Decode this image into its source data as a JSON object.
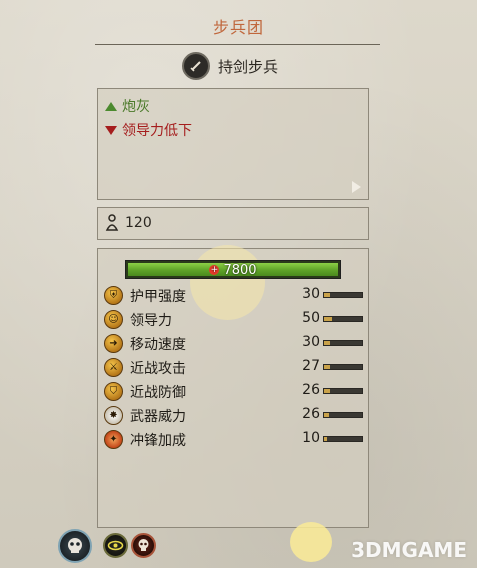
{
  "header": {
    "title": "步兵团"
  },
  "unit": {
    "type_label": "持剑步兵",
    "type_icon": "sword-icon"
  },
  "traits": [
    {
      "label": "炮灰",
      "kind": "positive",
      "color": "#4b7a2a"
    },
    {
      "label": "领导力低下",
      "kind": "negative",
      "color": "#a51d1d"
    }
  ],
  "men": {
    "count": "120"
  },
  "health": {
    "value": "7800",
    "fill_fraction": 1.0
  },
  "stats": [
    {
      "label": "护甲强度",
      "value": "30",
      "icon": "armor-icon",
      "fill": 0.15
    },
    {
      "label": "领导力",
      "value": "50",
      "icon": "leadership-icon",
      "fill": 0.2
    },
    {
      "label": "移动速度",
      "value": "30",
      "icon": "speed-icon",
      "fill": 0.15
    },
    {
      "label": "近战攻击",
      "value": "27",
      "icon": "melee-attack-icon",
      "fill": 0.15
    },
    {
      "label": "近战防御",
      "value": "26",
      "icon": "melee-defense-icon",
      "fill": 0.15
    },
    {
      "label": "武器威力",
      "value": "26",
      "icon": "weapon-strength-icon",
      "fill": 0.12
    },
    {
      "label": "冲锋加成",
      "value": "10",
      "icon": "charge-bonus-icon",
      "fill": 0.08
    }
  ],
  "watermark": "3DMGAME",
  "colors": {
    "title": "#c0673c",
    "positive": "#4b7a2a",
    "negative": "#a51d1d",
    "health": "#5fa328"
  }
}
